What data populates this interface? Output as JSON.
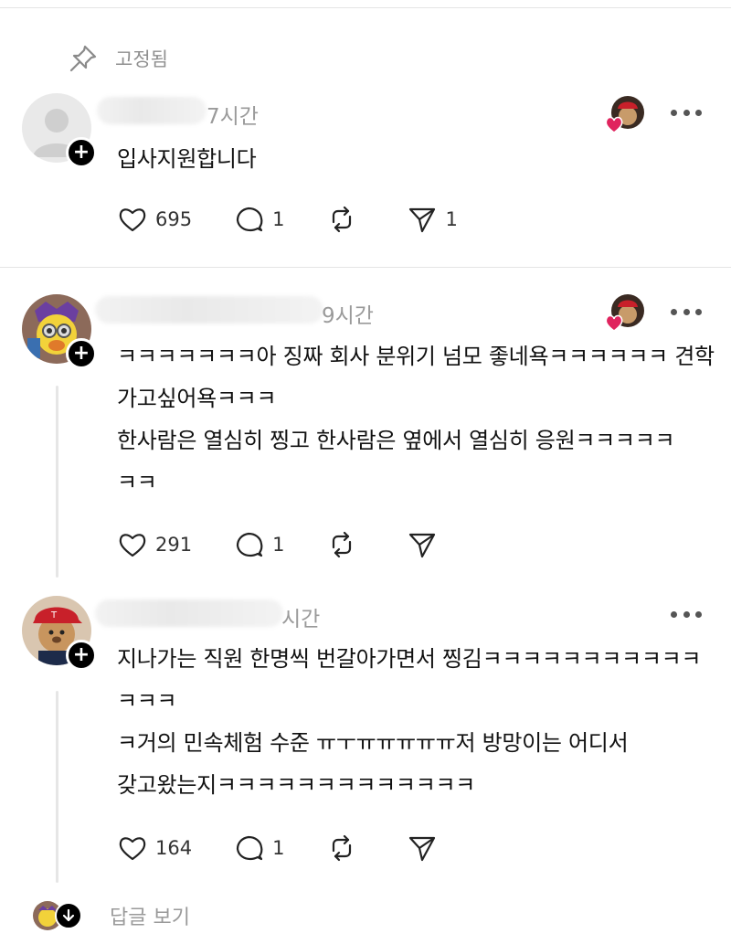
{
  "pinned": {
    "label": "고정됨"
  },
  "posts": [
    {
      "time": "7시간",
      "text": "입사지원합니다",
      "likes": "695",
      "comments": "1",
      "reposts": "",
      "shares": "1"
    },
    {
      "time": "9시간",
      "text": "ㅋㅋㅋㅋㅋㅋㅋ아 징짜 회사 분위기 넘모 좋네욕ㅋㅋㅋㅋㅋㅋ 견학\n가고싶어욕ㅋㅋㅋ\n한사람은 열심히 찡고 한사람은 옆에서 열심히 응원ㅋㅋㅋㅋㅋ\nㅋㅋ",
      "likes": "291",
      "comments": "1",
      "reposts": "",
      "shares": ""
    },
    {
      "time": "시간",
      "text": "지나가는 직원 한명씩 번갈아가면서 찡김ㅋㅋㅋㅋㅋㅋㅋㅋㅋㅋㅋ\nㅋㅋㅋ\nㅋ거의 민속체험 수준 ㅠㅜㅠㅠㅠㅠㅠ저 방망이는 어디서\n갖고왔는지ㅋㅋㅋㅋㅋㅋㅋㅋㅋㅋㅋㅋㅋ",
      "likes": "164",
      "comments": "1",
      "reposts": "",
      "shares": ""
    }
  ],
  "replies": {
    "label": "답글 보기"
  },
  "icons": {
    "pin": "pin-icon",
    "like": "heart-icon",
    "comment": "comment-icon",
    "repost": "repost-icon",
    "share": "send-icon",
    "more": "more-icon",
    "follow": "plus-icon"
  },
  "colors": {
    "heart": "#e0245e",
    "muted": "#9a9a9a",
    "accent": "#000000"
  }
}
